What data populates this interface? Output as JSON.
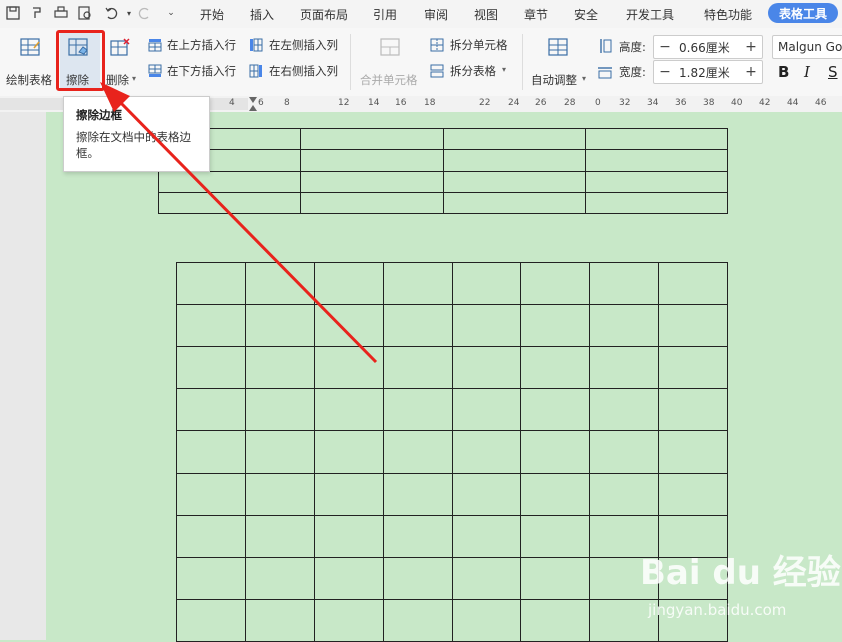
{
  "menubar": {
    "items": [
      "开始",
      "插入",
      "页面布局",
      "引用",
      "审阅",
      "视图",
      "章节",
      "安全",
      "开发工具",
      "特色功能"
    ],
    "active_tab": "表格工具"
  },
  "ribbon": {
    "draw_table": "绘制表格",
    "erase": "擦除",
    "delete": "删除",
    "insert_above": "在上方插入行",
    "insert_below": "在下方插入行",
    "insert_left": "在左侧插入列",
    "insert_right": "在右侧插入列",
    "merge_cells": "合并单元格",
    "split_cells": "拆分单元格",
    "split_table": "拆分表格",
    "auto_fit": "自动调整",
    "height_label": "高度:",
    "height_value": "0.66厘米",
    "width_label": "宽度:",
    "width_value": "1.82厘米",
    "font_name": "Malgun Go",
    "bold": "B",
    "italic": "I",
    "underline": "S"
  },
  "ruler": {
    "labels": [
      "4",
      "6",
      "8",
      "12",
      "14",
      "16",
      "18",
      "22",
      "24",
      "26",
      "28",
      "0",
      "32",
      "34",
      "36",
      "38",
      "40",
      "42",
      "44",
      "46"
    ]
  },
  "tooltip": {
    "title": "擦除边框",
    "description": "擦除在文档中的表格边框。"
  },
  "tables": {
    "top": {
      "rows": 4,
      "cols": 4
    },
    "bottom": {
      "rows": 9,
      "cols": 8
    }
  },
  "watermark": {
    "text": "Bai du 经验",
    "url": "jingyan.baidu.com"
  },
  "colors": {
    "page_background": "#c8e8c8",
    "highlight": "#e8231c",
    "active_tab": "#4a86e8"
  }
}
